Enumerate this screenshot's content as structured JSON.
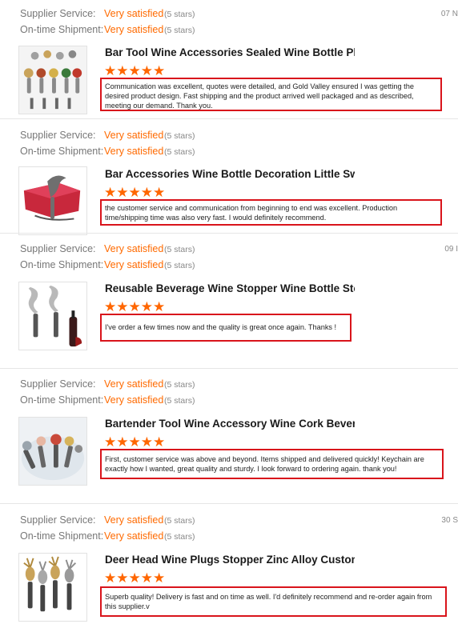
{
  "labels": {
    "supplier_service": "Supplier Service:",
    "on_time_shipment": "On-time Shipment:"
  },
  "reviews": [
    {
      "supplier_service": "Very satisfied",
      "supplier_stars": "(5 stars)",
      "shipment": "Very satisfied",
      "shipment_stars": "(5 stars)",
      "date": "07 N",
      "title": "Bar Tool Wine Accessories Sealed Wine Bottle Plug B",
      "rating": 5,
      "comment": "Communication was excellent, quotes were detailed, and Gold Valley ensured I was getting the desired product design. Fast shipping and the product arrived well packaged and as described, meeting our demand. Thank you."
    },
    {
      "supplier_service": "Very satisfied",
      "supplier_stars": "(5 stars)",
      "shipment": "Very satisfied",
      "shipment_stars": "(5 stars)",
      "date": "",
      "title": "Bar Accessories Wine Bottle Decoration Little Swan Sh",
      "rating": 5,
      "comment": "the customer service and communication from beginning to end was excellent. Production time/shipping time was also very fast. I would definitely recommend."
    },
    {
      "supplier_service": "Very satisfied",
      "supplier_stars": "(5 stars)",
      "shipment": "Very satisfied",
      "shipment_stars": "(5 stars)",
      "date": "09 I",
      "title": "Reusable Beverage Wine Stopper Wine Bottle Stopper C",
      "rating": 5,
      "comment": "I've order a few times now and the quality is great once again. Thanks !"
    },
    {
      "supplier_service": "Very satisfied",
      "supplier_stars": "(5 stars)",
      "shipment": "Very satisfied",
      "shipment_stars": "(5 stars)",
      "date": "",
      "title": "Bartender Tool Wine Accessory Wine Cork Beverage Bottle L",
      "rating": 5,
      "comment": "First, customer service was above and beyond. Items shipped and delivered quickly! Keychain are exactly how I wanted, great quality and sturdy. I look forward to ordering again. thank you!"
    },
    {
      "supplier_service": "Very satisfied",
      "supplier_stars": "(5 stars)",
      "shipment": "Very satisfied",
      "shipment_stars": "(5 stars)",
      "date": "30 S",
      "title": "Deer Head Wine Plugs Stopper Zinc Alloy Custom Wine Stop",
      "rating": 5,
      "comment": "Superb quality! Delivery is fast and on time as well. I'd definitely recommend and re-order again from this supplier.v"
    }
  ],
  "colors": {
    "accent": "#ff6a00",
    "star": "#ff6600",
    "highlight_border": "#d9141b",
    "label": "#777777"
  },
  "icons": {
    "rating_star": "star-icon",
    "product_image": "product-thumbnail"
  }
}
